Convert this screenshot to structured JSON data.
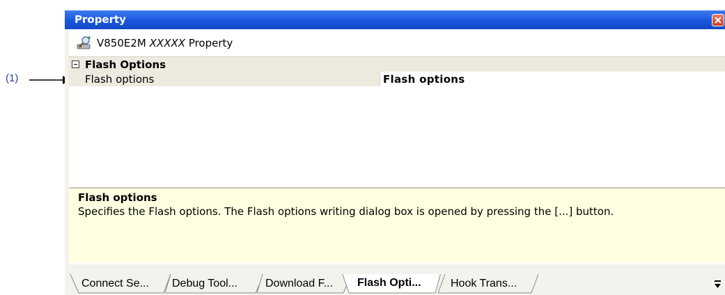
{
  "callout": {
    "label": "(1)"
  },
  "window": {
    "title": "Property",
    "close_icon": "close-icon"
  },
  "header": {
    "icon": "property-icon",
    "device": "V850E2M",
    "placeholder": "XXXXX",
    "suffix": "Property"
  },
  "grid": {
    "category": {
      "label": "Flash Options",
      "expanded": true
    },
    "rows": [
      {
        "name": "Flash options",
        "value": "Flash options"
      }
    ]
  },
  "description": {
    "title": "Flash options",
    "text": "Specifies the Flash options. The Flash options writing  dialog box is opened by pressing the [...] button."
  },
  "tabs": [
    {
      "label": "Connect Se...",
      "active": false
    },
    {
      "label": "Debug Tool...",
      "active": false
    },
    {
      "label": "Download F...",
      "active": false
    },
    {
      "label": "Flash Opti...",
      "active": true
    },
    {
      "label": "Hook Trans...",
      "active": false
    }
  ],
  "colors": {
    "titlebar": "#1a56dc",
    "category_bg": "#edeae0",
    "description_bg": "#ffffe1",
    "callout": "#2b3fa0"
  }
}
